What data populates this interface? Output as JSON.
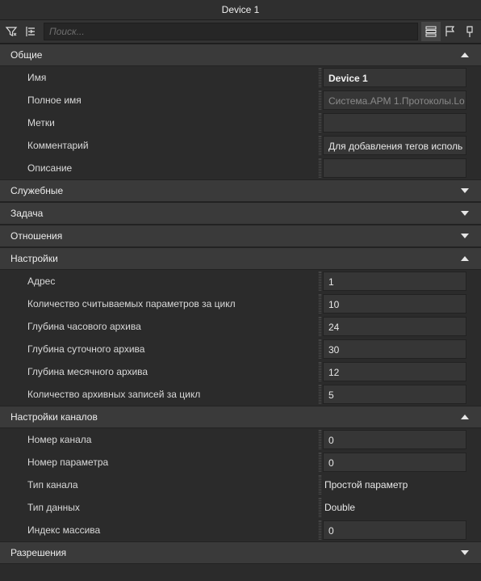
{
  "window": {
    "title": "Device 1"
  },
  "toolbar": {
    "search_placeholder": "Поиск...",
    "left_icons": [
      "filter-icon",
      "collapse-icon"
    ],
    "right_icons": [
      "list-view-icon",
      "flag-icon",
      "pin-icon"
    ]
  },
  "sections": {
    "general": {
      "title": "Общие",
      "rows": [
        {
          "label": "Имя",
          "value": "Device 1"
        },
        {
          "label": "Полное имя",
          "value": "Система.АРМ 1.Протоколы.Lo"
        },
        {
          "label": "Метки",
          "value": ""
        },
        {
          "label": "Комментарий",
          "value": "Для добавления тегов исполь"
        },
        {
          "label": "Описание",
          "value": ""
        }
      ]
    },
    "service": {
      "title": "Служебные"
    },
    "task": {
      "title": "Задача"
    },
    "relations": {
      "title": "Отношения"
    },
    "settings": {
      "title": "Настройки",
      "rows": [
        {
          "label": "Адрес",
          "value": "1"
        },
        {
          "label": "Количество считываемых параметров за цикл",
          "value": "10"
        },
        {
          "label": "Глубина часового архива",
          "value": "24"
        },
        {
          "label": "Глубина суточного архива",
          "value": "30"
        },
        {
          "label": "Глубина месячного архива",
          "value": "12"
        },
        {
          "label": "Количество архивных записей за цикл",
          "value": "5"
        }
      ]
    },
    "channel_settings": {
      "title": "Настройки каналов",
      "rows": [
        {
          "label": "Номер канала",
          "value": "0"
        },
        {
          "label": "Номер параметра",
          "value": "0"
        },
        {
          "label": "Тип канала",
          "value": "Простой параметр"
        },
        {
          "label": "Тип данных",
          "value": "Double"
        },
        {
          "label": "Индекс массива",
          "value": "0"
        }
      ]
    },
    "permissions": {
      "title": "Разрешения"
    }
  }
}
